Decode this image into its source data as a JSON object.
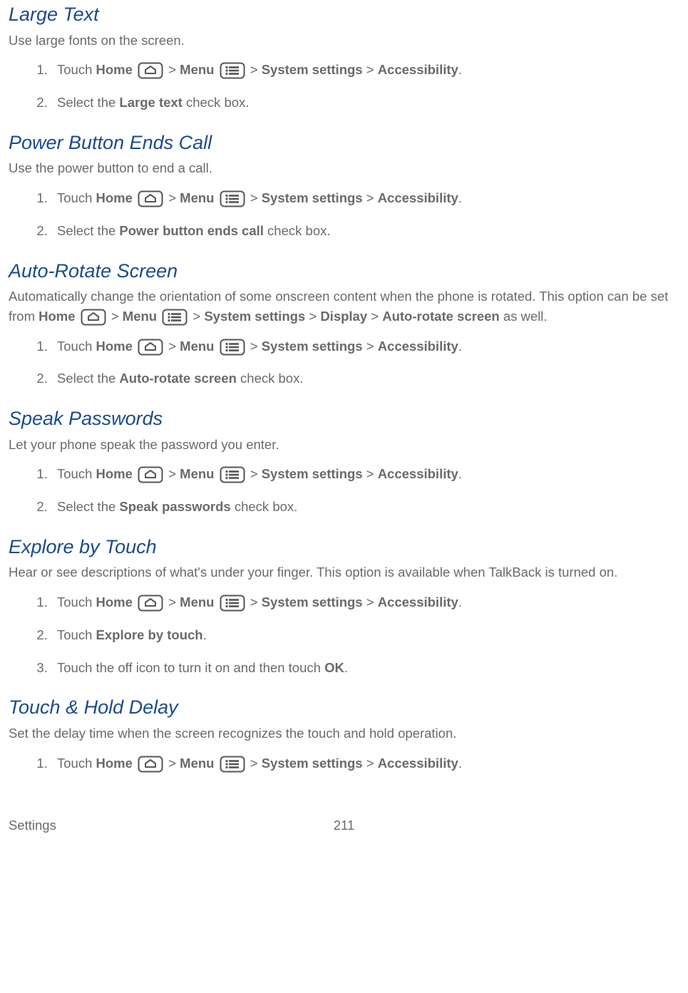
{
  "common": {
    "touch": "Touch ",
    "home": "Home",
    "menu": "Menu",
    "systemSettings": "System settings",
    "accessibility": "Accessibility",
    "gt": " > ",
    "period": ".",
    "selectThe": "Select the ",
    "checkbox": " check box."
  },
  "sections": {
    "largeText": {
      "title": "Large Text",
      "desc": "Use large fonts on the screen.",
      "opt": "Large text"
    },
    "powerButton": {
      "title": "Power Button Ends Call",
      "desc": "Use the power button to end a call.",
      "opt": "Power button ends call"
    },
    "autoRotate": {
      "title": "Auto-Rotate Screen",
      "desc1": "Automatically change the orientation of some onscreen content when the phone is rotated. This option can be set from ",
      "desc2": " as well.",
      "display": "Display",
      "autorotate": "Auto-rotate screen",
      "opt": "Auto-rotate screen"
    },
    "speakPasswords": {
      "title": "Speak Passwords",
      "desc": "Let your phone speak the password you enter.",
      "opt": "Speak passwords"
    },
    "exploreByTouch": {
      "title": "Explore by Touch",
      "desc": "Hear or see descriptions of what's under your finger. This option is available when TalkBack is turned on.",
      "step2a": "Touch ",
      "step2b": "Explore by touch",
      "step3a": "Touch the off icon to turn it on and then touch ",
      "step3b": "OK"
    },
    "touchHold": {
      "title": "Touch & Hold Delay",
      "desc": "Set the delay time when the screen recognizes the touch and hold operation."
    }
  },
  "footer": {
    "left": "Settings",
    "page": "211"
  }
}
